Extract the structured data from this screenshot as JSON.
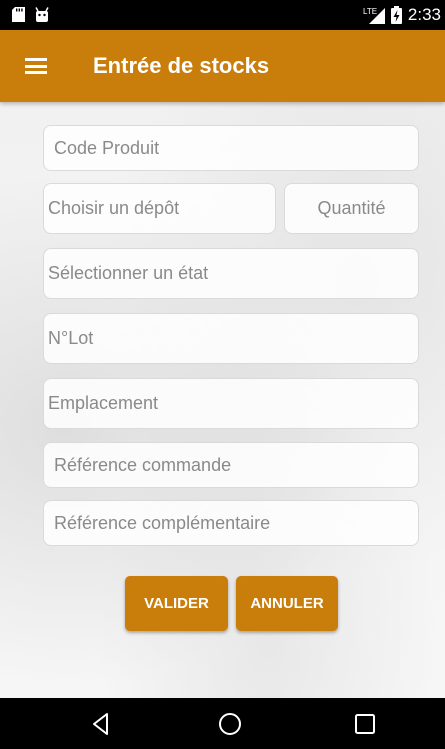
{
  "status_bar": {
    "network": "LTE",
    "time": "2:33"
  },
  "app_bar": {
    "title": "Entrée de stocks",
    "menu_icon": "hamburger-menu-icon",
    "color": "#c97d0b"
  },
  "form": {
    "code_produit": {
      "placeholder": "Code Produit",
      "value": ""
    },
    "depot": {
      "placeholder": "Choisir un dépôt",
      "value": ""
    },
    "quantite": {
      "placeholder": "Quantité",
      "value": ""
    },
    "etat": {
      "placeholder": "Sélectionner un état",
      "value": ""
    },
    "lot": {
      "placeholder": "N°Lot",
      "value": ""
    },
    "emplacement": {
      "placeholder": "Emplacement",
      "value": ""
    },
    "reference_commande": {
      "placeholder": "Référence commande",
      "value": ""
    },
    "reference_complementaire": {
      "placeholder": "Référence complémentaire",
      "value": ""
    }
  },
  "buttons": {
    "valider": "VALIDER",
    "annuler": "ANNULER"
  },
  "nav_bar": {
    "icons": [
      "back-icon",
      "home-icon",
      "recents-icon"
    ]
  }
}
